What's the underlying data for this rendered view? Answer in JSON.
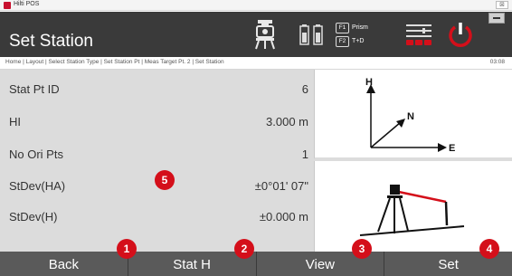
{
  "window": {
    "title": "Hilti POS",
    "close_glyph": "⊠"
  },
  "header": {
    "title": "Set Station",
    "f1_key": "F1",
    "f1_label": "Prism",
    "f2_key": "F2",
    "f2_label": "T+D"
  },
  "breadcrumb": {
    "path": "Home | Layout | Select Station Type | Set Station Pt | Meas Target Pt. 2 | Set Station",
    "time": "03:08"
  },
  "rows": [
    {
      "label": "Stat Pt ID",
      "value": "6"
    },
    {
      "label": "HI",
      "value": "3.000 m"
    },
    {
      "label": "No Ori Pts",
      "value": "1"
    },
    {
      "label": "StDev(HA)",
      "value": "±0°01' 07\""
    },
    {
      "label": "StDev(H)",
      "value": "±0.000 m"
    }
  ],
  "diagram": {
    "axis_h": "H",
    "axis_n": "N",
    "axis_e": "E"
  },
  "softkeys": [
    {
      "label": "Back"
    },
    {
      "label": "Stat H"
    },
    {
      "label": "View"
    },
    {
      "label": "Set"
    }
  ],
  "callouts": [
    "1",
    "2",
    "3",
    "4",
    "5"
  ],
  "colors": {
    "header_bg": "#3a3a3a",
    "hilti_red": "#d40f1a",
    "content_bg": "#dcdcdc",
    "softkey_bg": "#5a5a5a"
  },
  "icons": {
    "tripod": "tripod-instrument-icon",
    "battery": "battery-icon",
    "menu": "menu-bars-icon",
    "power": "power-icon",
    "minimize": "minimize-icon"
  }
}
